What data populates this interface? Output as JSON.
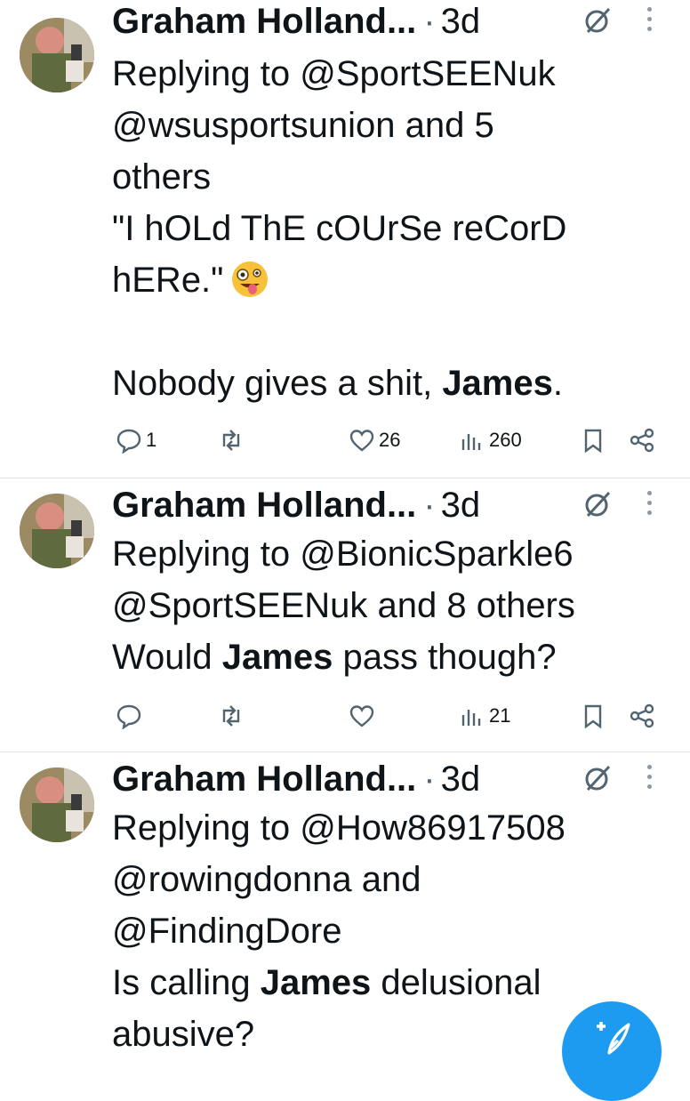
{
  "tweets": [
    {
      "author": "Graham Holland...",
      "separator": "·",
      "time": "3d",
      "reply_prefix": "Replying to",
      "reply_line1": "@SportSEENuk",
      "reply_line2": "@wsusportsunion and 5",
      "reply_line3": "others",
      "text_l1": "\"I hOLd ThE cOUrSe reCorD",
      "text_l2": "hERe.\"",
      "text_l3_pre": "Nobody gives a shit, ",
      "text_l3_bold": "James",
      "text_l3_post": ".",
      "replies": "1",
      "reposts": "",
      "likes": "26",
      "views": "260"
    },
    {
      "author": "Graham Holland...",
      "separator": "·",
      "time": "3d",
      "reply_prefix": "Replying to",
      "reply_line1": "@BionicSparkle6",
      "reply_line2": "@SportSEENuk and 8 others",
      "text_pre": "Would ",
      "text_bold": "James",
      "text_post": " pass though?",
      "replies": "",
      "reposts": "",
      "likes": "",
      "views": "21"
    },
    {
      "author": "Graham Holland...",
      "separator": "·",
      "time": "3d",
      "reply_prefix": "Replying to",
      "reply_line1": "@How86917508",
      "reply_line2": "@rowingdonna and",
      "reply_line3": "@FindingDore",
      "text_pre": "Is calling ",
      "text_bold": "James",
      "text_post": " delusional",
      "text_l2": "abusive?"
    }
  ],
  "colors": {
    "accent": "#1d9bf0",
    "muted": "#536471",
    "divider": "#dfe3e6"
  },
  "icons": [
    "reply-icon",
    "repost-icon",
    "like-icon",
    "views-icon",
    "bookmark-icon",
    "share-icon",
    "grok-icon",
    "more-icon",
    "compose-icon"
  ]
}
